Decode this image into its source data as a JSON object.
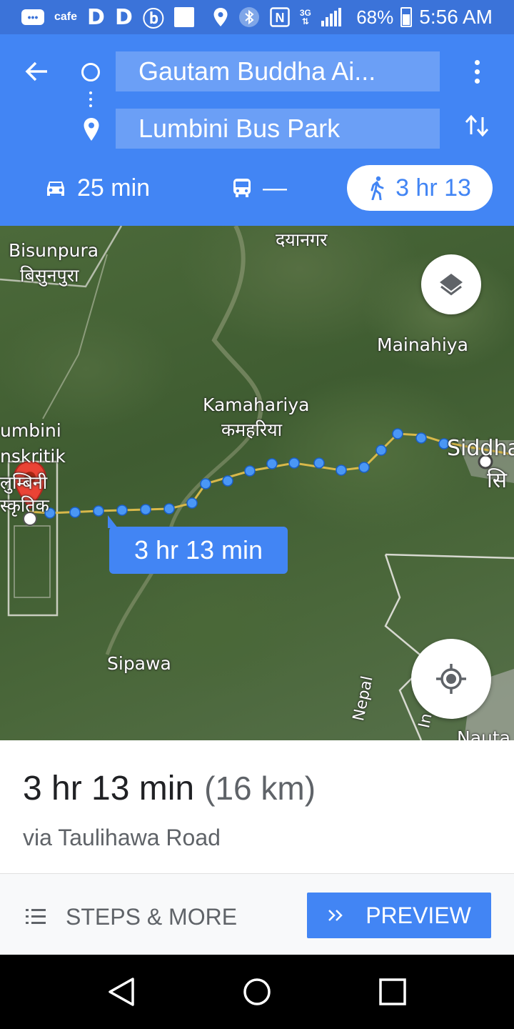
{
  "status_bar": {
    "left_icons": [
      "message-icon",
      "cafe-icon",
      "d-app-icon",
      "d-app-icon",
      "b-app-icon",
      "square-app-icon",
      "location-icon",
      "bluetooth-icon",
      "nfc-icon",
      "data-3g-icon",
      "signal-icon"
    ],
    "cafe_label": "cafe",
    "data_label": "3G",
    "battery": "68%",
    "time": "5:56 AM"
  },
  "header": {
    "origin": "Gautam Buddha Ai...",
    "destination": "Lumbini Bus Park",
    "modes": {
      "drive": "25 min",
      "transit": "—",
      "walk": "3 hr 13"
    },
    "selected_mode": "walk"
  },
  "map": {
    "labels": {
      "bisunpura": "Bisunpura",
      "bisunpura_hi": "बिसुनपुरा",
      "dayanagar_hi": "दयानगर",
      "mainahiya": "Mainahiya",
      "kamahariya": "Kamahariya",
      "kamahariya_hi": "कमहरिया",
      "lumbini": "umbini",
      "sanskritik": "nskritik",
      "lumbini_hi_1": "लुम्बिनी",
      "lumbini_hi_2": "स्कृतिक",
      "siddha": "Siddha",
      "siddha_hi": "सि",
      "sipawa": "Sipawa",
      "nepal": "Nepal",
      "india": "In",
      "nautanwa": "Nauta"
    },
    "route_label": "3 hr 13 min",
    "colors": {
      "route": "#4285f4",
      "pin": "#ea4335"
    }
  },
  "sheet": {
    "duration": "3 hr 13 min",
    "distance": "(16 km)",
    "via": "via Taulihawa Road",
    "steps_label": "STEPS & MORE",
    "preview_label": "PREVIEW"
  }
}
